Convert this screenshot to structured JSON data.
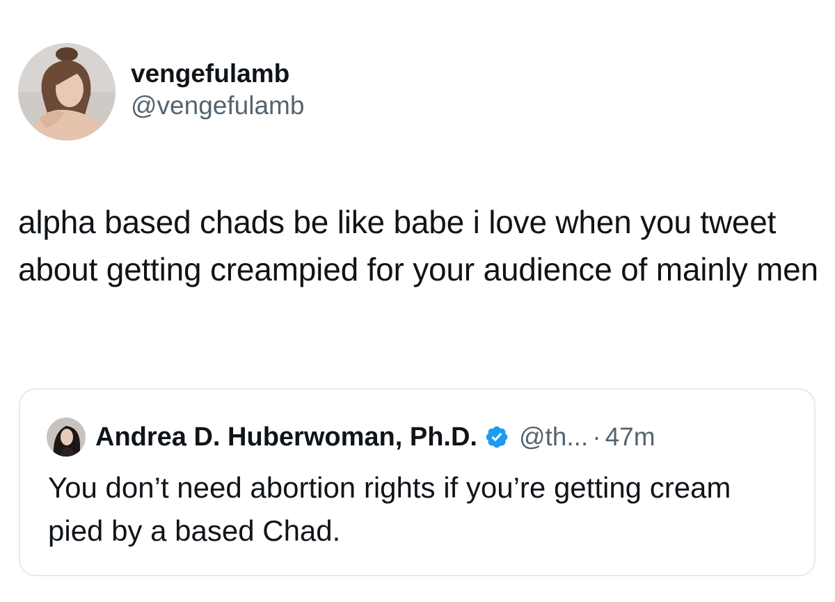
{
  "tweet": {
    "author": {
      "display_name": "vengefulamb",
      "handle": "@vengefulamb",
      "avatar": "profile-photo"
    },
    "text": "alpha based chads be like babe i love when you tweet about getting creampied for your audience of mainly men"
  },
  "quoted_tweet": {
    "author": {
      "display_name": "Andrea D. Huberwoman, Ph.D.",
      "handle": "@th...",
      "verified": true,
      "verified_icon": "verified-badge-icon",
      "avatar": "profile-photo"
    },
    "separator": "·",
    "time": "47m",
    "text": "You don’t need abortion rights if you’re getting cream pied by a based Chad."
  },
  "colors": {
    "text_primary": "#0f1419",
    "text_secondary": "#536471",
    "verified_blue": "#1d9bf0",
    "border": "#e7eaed",
    "background": "#ffffff"
  }
}
